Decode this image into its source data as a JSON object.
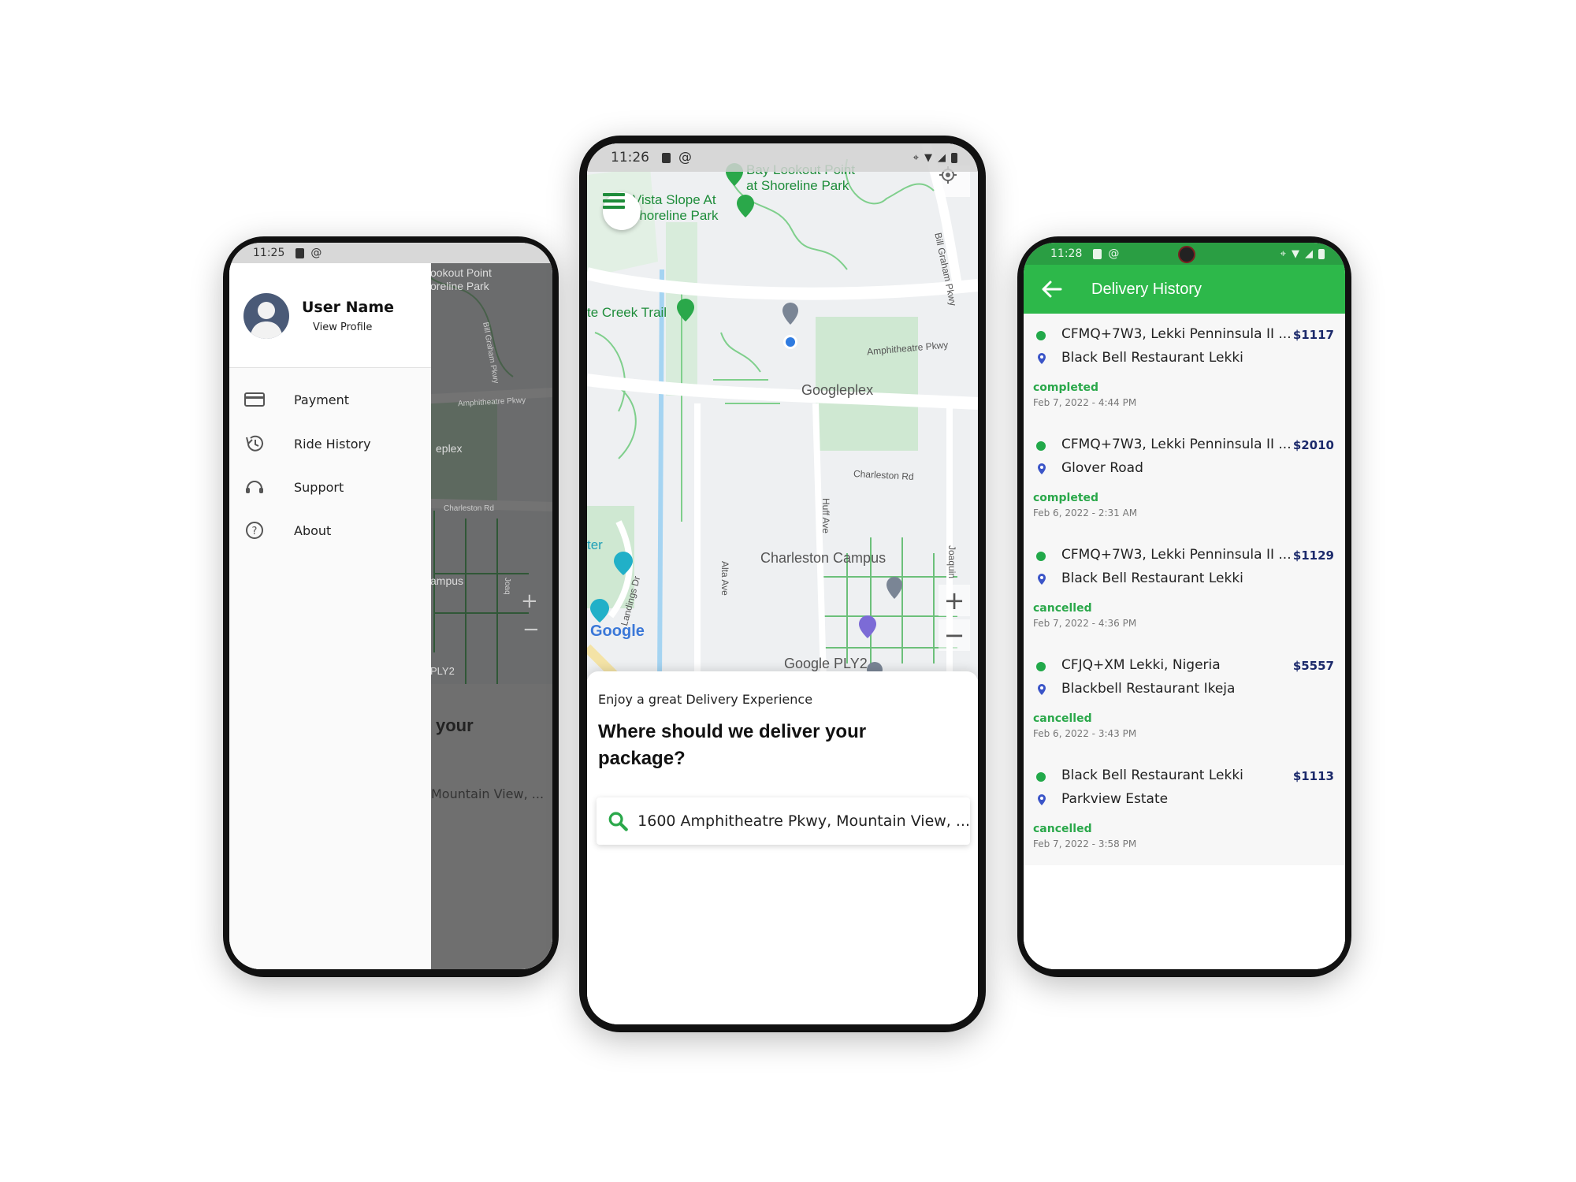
{
  "left_phone": {
    "status_time": "11:25",
    "drawer": {
      "user_name": "User Name",
      "view_profile": "View Profile",
      "items": [
        {
          "label": "Payment",
          "icon": "card-icon"
        },
        {
          "label": "Ride History",
          "icon": "history-icon"
        },
        {
          "label": "Support",
          "icon": "headset-icon"
        },
        {
          "label": "About",
          "icon": "help-icon"
        }
      ]
    },
    "background": {
      "poi_label_line1": "ookout Point",
      "poi_label_line2": "oreline Park",
      "road_label_1": "Bill Graham Pkwy",
      "road_label_2": "Amphitheatre Pkwy",
      "place_label_1": "eplex",
      "road_label_3": "Charleston Rd",
      "place_label_2": "ampus",
      "place_label_3": "PLY2",
      "road_label_4": "Joaq",
      "heading_fragment": "your",
      "search_fragment": "Mountain View, ..."
    }
  },
  "center_phone": {
    "status_time": "11:26",
    "map": {
      "labels": {
        "bay_lookout_1": "Bay Lookout Point",
        "bay_lookout_2": "at Shoreline Park",
        "vista_1": "Vista Slope At",
        "vista_2": "Shoreline Park",
        "creek_trail": "te Creek Trail",
        "amphitheatre": "Amphitheatre Pkwy",
        "bill_graham": "Bill Graham Pkwy",
        "googleplex": "Googleplex",
        "charleston_rd": "Charleston Rd",
        "huff_ave": "Huff Ave",
        "alta_ave": "Alta Ave",
        "landings_dr": "Landings Dr",
        "charleston_campus": "Charleston Campus",
        "joaquin": "Joaquin",
        "center_frag": "ter",
        "google_ply2": "Google PLY2",
        "google_logo": "Google"
      },
      "zoom_in": "+",
      "zoom_out": "−"
    },
    "sheet": {
      "subtitle": "Enjoy a great Delivery Experience",
      "title": "Where should we deliver your package?",
      "search_value": "1600 Amphitheatre Pkwy, Mountain View, ..."
    }
  },
  "right_phone": {
    "status_time": "11:28",
    "header_title": "Delivery History",
    "accent_color": "#2db84a",
    "deliveries": [
      {
        "from": "CFMQ+7W3, Lekki Penninsula II ...",
        "to": "Black Bell Restaurant Lekki",
        "price": "$1117",
        "status": "completed",
        "date": "Feb 7, 2022 - 4:44 PM"
      },
      {
        "from": "CFMQ+7W3, Lekki Penninsula II ...",
        "to": "Glover Road",
        "price": "$2010",
        "status": "completed",
        "date": "Feb 6, 2022 - 2:31 AM"
      },
      {
        "from": "CFMQ+7W3, Lekki Penninsula II ...",
        "to": "Black Bell Restaurant Lekki",
        "price": "$1129",
        "status": "cancelled",
        "date": "Feb 7, 2022 - 4:36 PM"
      },
      {
        "from": "CFJQ+XM Lekki, Nigeria",
        "to": "Blackbell Restaurant Ikeja",
        "price": "$5557",
        "status": "cancelled",
        "date": "Feb 6, 2022 - 3:43 PM"
      },
      {
        "from": "Black Bell Restaurant Lekki",
        "to": "Parkview Estate",
        "price": "$1113",
        "status": "cancelled",
        "date": "Feb 7, 2022 - 3:58 PM"
      }
    ]
  }
}
